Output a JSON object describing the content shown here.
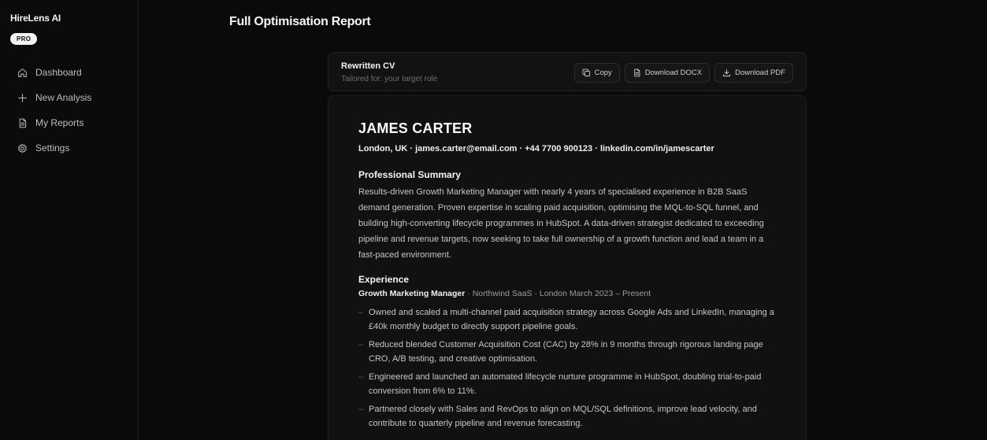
{
  "sidebar": {
    "brand": "HireLens AI",
    "badge": "PRO",
    "items": [
      {
        "label": "Dashboard",
        "icon": "home-icon"
      },
      {
        "label": "New Analysis",
        "icon": "plus-icon"
      },
      {
        "label": "My Reports",
        "icon": "document-icon"
      },
      {
        "label": "Settings",
        "icon": "gear-icon"
      }
    ]
  },
  "main": {
    "page_title": "Full Optimisation Report",
    "cv_header": {
      "title": "Rewritten CV",
      "subtitle": "Tailored for: your target role",
      "copy_label": "Copy",
      "docx_label": "Download DOCX",
      "pdf_label": "Download PDF"
    },
    "cv": {
      "name": "JAMES CARTER",
      "contact": "London, UK · james.carter@email.com · +44 7700 900123 · linkedin.com/in/jamescarter",
      "summary_heading": "Professional Summary",
      "summary": "Results-driven Growth Marketing Manager with nearly 4 years of specialised experience in B2B SaaS demand generation. Proven expertise in scaling paid acquisition, optimising the MQL-to-SQL funnel, and building high-converting lifecycle programmes in HubSpot. A data-driven strategist dedicated to exceeding pipeline and revenue targets, now seeking to take full ownership of a growth function and lead a team in a fast-paced environment.",
      "experience_heading": "Experience",
      "role_title": "Growth Marketing Manager",
      "role_meta": " · Northwind SaaS · London March 2023 – Present",
      "bullets": [
        "Owned and scaled a multi-channel paid acquisition strategy across Google Ads and LinkedIn, managing a £40k monthly budget to directly support pipeline goals.",
        "Reduced blended Customer Acquisition Cost (CAC) by 28% in 9 months through rigorous landing page CRO, A/B testing, and creative optimisation.",
        "Engineered and launched an automated lifecycle nurture programme in HubSpot, doubling trial-to-paid conversion from 6% to 11%.",
        "Partnered closely with Sales and RevOps to align on MQL/SQL definitions, improve lead velocity, and contribute to quarterly pipeline and revenue forecasting."
      ]
    }
  }
}
